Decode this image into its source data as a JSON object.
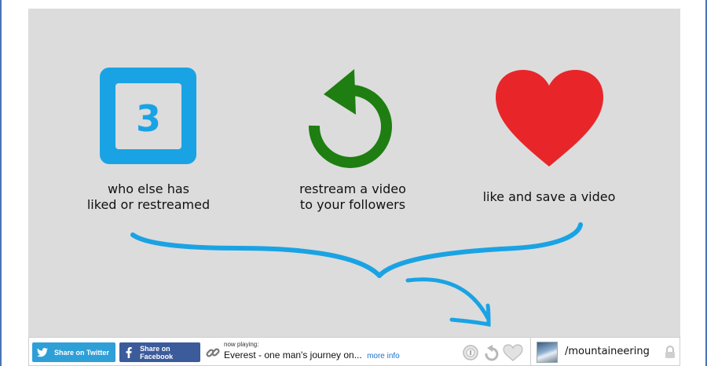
{
  "features": [
    {
      "label": "who else has\nliked or restreamed",
      "badge": "3",
      "icon": "count-badge-icon",
      "color": "#1aa3e4"
    },
    {
      "label": "restream a video\nto your followers",
      "icon": "restream-arrow-icon",
      "color": "#1e7e11"
    },
    {
      "label": "like and save a video",
      "icon": "heart-icon",
      "color": "#e8262a"
    }
  ],
  "brace_color": "#1aa3e4",
  "share": {
    "twitter_label": "Share on Twitter",
    "facebook_label": "Share on Facebook"
  },
  "now_playing": {
    "label": "now playing:",
    "title": "Everest - one man's journey on...",
    "more_label": "more info"
  },
  "channel": {
    "name": "/mountaineering"
  }
}
